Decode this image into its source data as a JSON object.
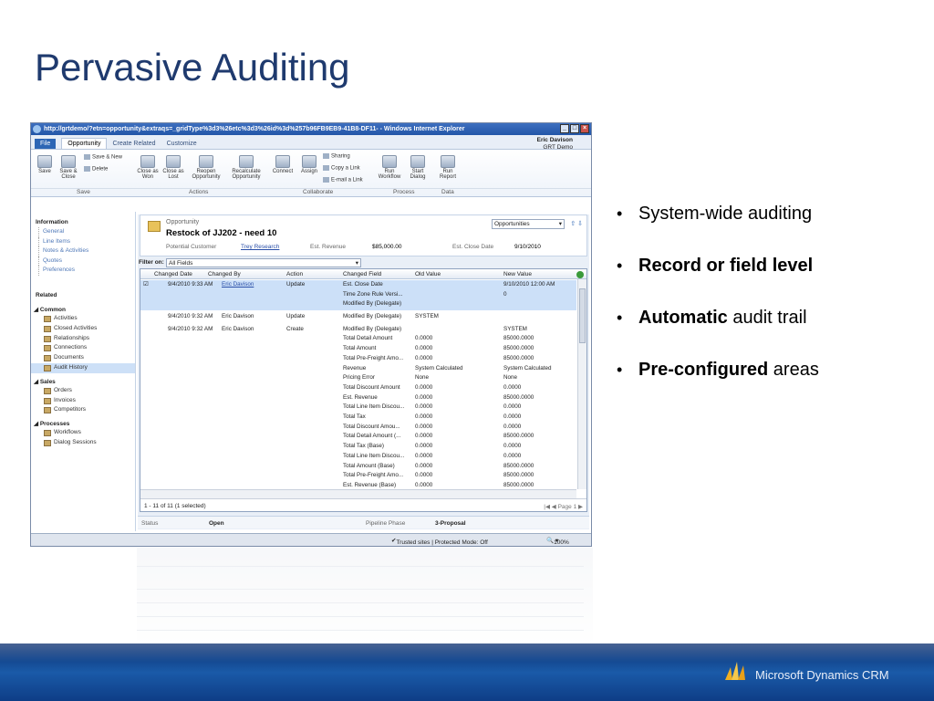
{
  "slide": {
    "title": "Pervasive Auditing",
    "bullets": [
      {
        "bold": "",
        "text": "System-wide auditing"
      },
      {
        "bold": "Record or field level",
        "text": ""
      },
      {
        "bold": "Automatic",
        "text": " audit trail"
      },
      {
        "bold": "Pre-configured",
        "text": " areas"
      }
    ],
    "footer_brand": "Microsoft Dynamics CRM"
  },
  "window": {
    "title": "http://grtdemo/?etn=opportunity&extraqs=_gridType%3d3%26etc%3d3%26id%3d%257b96FB9EB9-41B8-DF11- - Windows Internet Explorer",
    "tabs": [
      "File",
      "Opportunity",
      "Create Related",
      "Customize"
    ],
    "user_name": "Eric Davison",
    "user_org": "GRT Demo"
  },
  "ribbon": {
    "save": "Save",
    "save_close": "Save & Close",
    "save_new": "Save & New",
    "delete": "Delete",
    "close_won": "Close as Won",
    "close_lost": "Close as Lost",
    "reopen": "Reopen Opportunity",
    "recalculate": "Recalculate Opportunity",
    "connect": "Connect",
    "assign": "Assign",
    "sharing": "Sharing",
    "copy_link": "Copy a Link",
    "email_link": "E-mail a Link",
    "run_workflow": "Run Workflow",
    "start_dialog": "Start Dialog",
    "run_report": "Run Report",
    "groups": [
      "Save",
      "Actions",
      "Collaborate",
      "Process",
      "Data"
    ]
  },
  "nav": {
    "information": "Information",
    "info_items": [
      "General",
      "Line Items",
      "Notes & Activities",
      "Quotes",
      "Preferences"
    ],
    "related": "Related",
    "common": "Common",
    "common_items": [
      "Activities",
      "Closed Activities",
      "Relationships",
      "Connections",
      "Documents",
      "Audit History"
    ],
    "sales": "Sales",
    "sales_items": [
      "Orders",
      "Invoices",
      "Competitors"
    ],
    "processes": "Processes",
    "process_items": [
      "Workflows",
      "Dialog Sessions"
    ]
  },
  "record": {
    "entity": "Opportunity",
    "name": "Restock of JJ202 - need 10",
    "potential_customer_label": "Potential Customer",
    "potential_customer": "Trey Research",
    "est_revenue_label": "Est. Revenue",
    "est_revenue": "$85,000.00",
    "est_close_label": "Est. Close Date",
    "est_close": "9/10/2010",
    "view_selector": "Opportunities"
  },
  "filter": {
    "label": "Filter on:",
    "value": "All Fields"
  },
  "grid": {
    "columns": [
      "Changed Date",
      "Changed By",
      "Action",
      "Changed Field",
      "Old Value",
      "New Value"
    ],
    "groups": [
      {
        "date": "9/4/2010 9:33 AM",
        "by": "Eric Davison",
        "action": "Update",
        "selected": true,
        "rows": [
          [
            "Est. Close Date",
            "",
            "9/10/2010 12:00 AM"
          ],
          [
            "Time Zone Rule Versi...",
            "",
            "0"
          ],
          [
            "Modified By (Delegate)",
            "",
            ""
          ]
        ]
      },
      {
        "date": "9/4/2010 9:32 AM",
        "by": "Eric Davison",
        "action": "Update",
        "selected": false,
        "rows": [
          [
            "Modified By (Delegate)",
            "SYSTEM",
            ""
          ]
        ]
      },
      {
        "date": "9/4/2010 9:32 AM",
        "by": "Eric Davison",
        "action": "Create",
        "selected": false,
        "rows": [
          [
            "Modified By (Delegate)",
            "",
            "SYSTEM"
          ],
          [
            "Total Detail Amount",
            "0.0000",
            "85000.0000"
          ],
          [
            "Total Amount",
            "0.0000",
            "85000.0000"
          ],
          [
            "Total Pre-Freight Amo...",
            "0.0000",
            "85000.0000"
          ],
          [
            "Revenue",
            "System Calculated",
            "System Calculated"
          ],
          [
            "Pricing Error",
            "None",
            "None"
          ],
          [
            "Total Discount Amount",
            "0.0000",
            "0.0000"
          ],
          [
            "Est. Revenue",
            "0.0000",
            "85000.0000"
          ],
          [
            "Total Line Item Discou...",
            "0.0000",
            "0.0000"
          ],
          [
            "Total Tax",
            "0.0000",
            "0.0000"
          ],
          [
            "Total Discount Amou...",
            "0.0000",
            "0.0000"
          ],
          [
            "Total Detail Amount (...",
            "0.0000",
            "85000.0000"
          ],
          [
            "Total Tax (Base)",
            "0.0000",
            "0.0000"
          ],
          [
            "Total Line Item Discou...",
            "0.0000",
            "0.0000"
          ],
          [
            "Total Amount (Base)",
            "0.0000",
            "85000.0000"
          ],
          [
            "Total Pre-Freight Amo...",
            "0.0000",
            "85000.0000"
          ],
          [
            "Est. Revenue (Base)",
            "0.0000",
            "85000.0000"
          ]
        ]
      }
    ],
    "footer_count": "1 - 11 of 11 (1 selected)",
    "footer_page": "Page 1"
  },
  "status": {
    "status_label": "Status",
    "status_value": "Open",
    "phase_label": "Pipeline Phase",
    "phase_value": "3-Proposal"
  },
  "ie_status": {
    "zone": "Trusted sites | Protected Mode: Off",
    "zoom": "100%"
  }
}
